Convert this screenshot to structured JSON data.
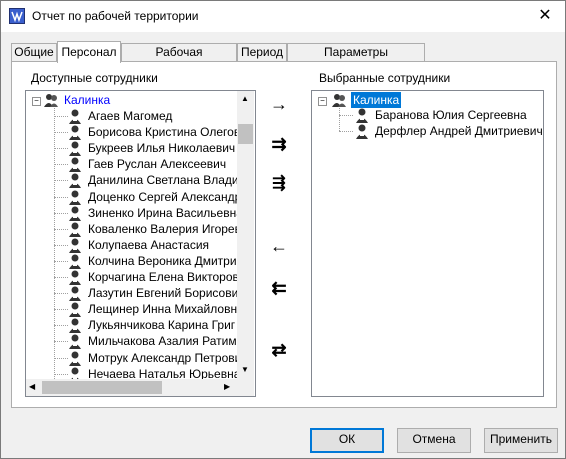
{
  "window": {
    "title": "Отчет по рабочей территории"
  },
  "tabs": [
    "Общие",
    "Персонал",
    "Рабочая территория",
    "Период",
    "Параметры отображения"
  ],
  "active_tab": "Персонал",
  "available": {
    "label": "Доступные сотрудники",
    "root": "Калинка",
    "items": [
      "Агаев Магомед",
      "Борисова Кристина Олегов",
      "Букреев Илья Николаевич",
      "Гаев Руслан Алексеевич",
      "Данилина Светлана Владим",
      "Доценко Сергей Александр",
      "Зиненко Ирина Васильевна",
      "Коваленко Валерия Игорев",
      "Колупаева Анастасия",
      "Колчина Вероника Дмитрие",
      "Корчагина Елена Викторов",
      "Лазутин Евгений Борисови",
      "Лещинер Инна Михайловна",
      "Лукьянчикова Карина Григ",
      "Мильчакова Азалия Ратимо",
      "Мотрук Александр Петрови",
      "Нечаева Наталья Юрьевна"
    ]
  },
  "selected": {
    "label": "Выбранные сотрудники",
    "root": "Калинка",
    "items": [
      "Баранова Юлия Сергеевна",
      "Дерфлер Андрей Дмитриевич"
    ]
  },
  "move_buttons": {
    "add": "→",
    "add_all": "⇉",
    "add_group": "⇶",
    "remove": "←",
    "remove_all": "⇇",
    "swap": "⇄"
  },
  "footer": {
    "ok": "ОК",
    "cancel": "Отмена",
    "apply": "Применить"
  }
}
